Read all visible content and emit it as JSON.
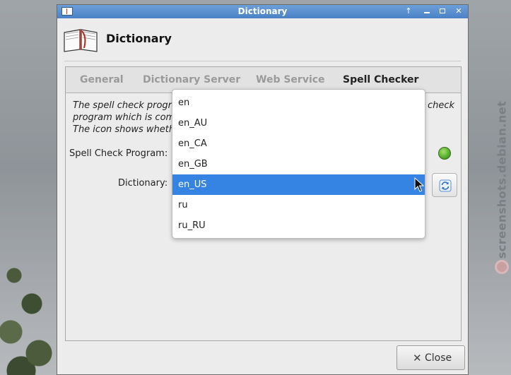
{
  "window": {
    "title": "Dictionary",
    "header_title": "Dictionary"
  },
  "tabs": [
    {
      "label": "General",
      "active": false
    },
    {
      "label": "Dictionary Server",
      "active": false
    },
    {
      "label": "Web Service",
      "active": false
    },
    {
      "label": "Spell Checker",
      "active": true
    }
  ],
  "spell_page": {
    "description_lines": [
      "The spell check progr",
      "program which is com",
      "The icon shows wheth"
    ],
    "description_tail": "check",
    "program_label": "Spell Check Program:",
    "dictionary_label": "Dictionary:",
    "status": "ok"
  },
  "dropdown": {
    "options": [
      "en",
      "en_AU",
      "en_CA",
      "en_GB",
      "en_US",
      "ru",
      "ru_RU"
    ],
    "selected": "en_US"
  },
  "buttons": {
    "close_label": "Close"
  },
  "watermark": {
    "text": "screenshots.debian.net"
  },
  "colors": {
    "titlebar": "#4a82c6",
    "selection": "#3584e4",
    "status_ok": "#58b130"
  }
}
